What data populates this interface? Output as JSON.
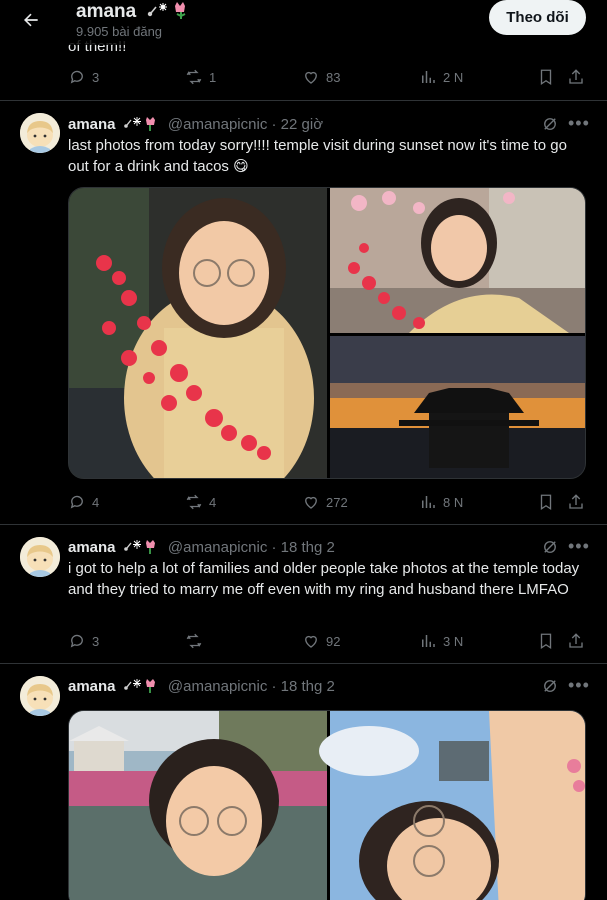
{
  "header": {
    "name": "amana",
    "post_count": "9.905 bài đăng",
    "follow_label": "Theo dõi"
  },
  "prev_tweet": {
    "tail_text": "of them!!",
    "replies": "3",
    "retweets": "1",
    "likes": "83",
    "views": "2 N"
  },
  "tweets": [
    {
      "name": "amana",
      "handle": "@amanapicnic",
      "time": "· 22 giờ",
      "text": "last photos from today sorry!!!! temple visit during sunset now it's time to go out for a drink and tacos 😋",
      "replies": "4",
      "retweets": "4",
      "likes": "272",
      "views": "8 N"
    },
    {
      "name": "amana",
      "handle": "@amanapicnic",
      "time": "· 18 thg 2",
      "text": "i got to help a lot of families and older people take photos at the temple today and they tried to marry me off even with my ring and husband there LMFAO",
      "replies": "3",
      "retweets": "",
      "likes": "92",
      "views": "3 N"
    },
    {
      "name": "amana",
      "handle": "@amanapicnic",
      "time": "· 18 thg 2"
    }
  ],
  "colors": {
    "background": "#000000",
    "text": "#e7e9ea",
    "muted": "#71767b",
    "border": "#2f3336",
    "follow_bg": "#eff3f4"
  }
}
